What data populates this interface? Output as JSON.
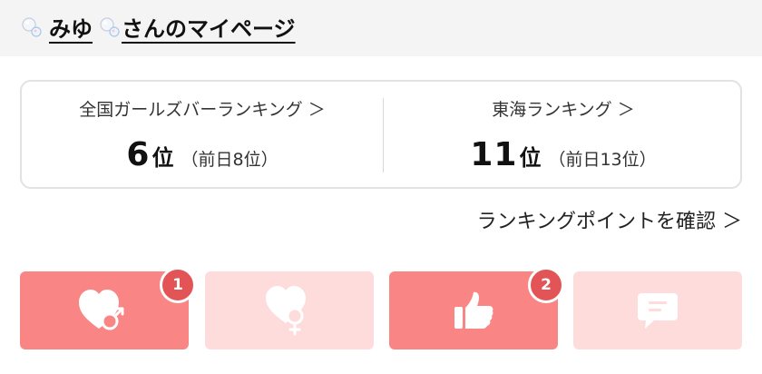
{
  "header": {
    "name": "みゆ",
    "suffix": "さんのマイページ"
  },
  "ranking": {
    "national": {
      "label": "全国ガールズバーランキング ＞",
      "rank": "6",
      "unit": "位",
      "previous": "（前日8位）"
    },
    "regional": {
      "label": "東海ランキング ＞",
      "rank": "11",
      "unit": "位",
      "previous": "（前日13位）"
    }
  },
  "point_link": "ランキングポイントを確認 ＞",
  "actions": [
    {
      "icon": "heart-male-icon",
      "badge": "1",
      "active": true
    },
    {
      "icon": "heart-female-icon",
      "badge": "",
      "active": false
    },
    {
      "icon": "thumbs-up-icon",
      "badge": "2",
      "active": true
    },
    {
      "icon": "chat-bubble-icon",
      "badge": "",
      "active": false
    }
  ],
  "colors": {
    "button_active": "#fa8585",
    "button_inactive": "#fedcdc",
    "badge": "#e35456"
  }
}
